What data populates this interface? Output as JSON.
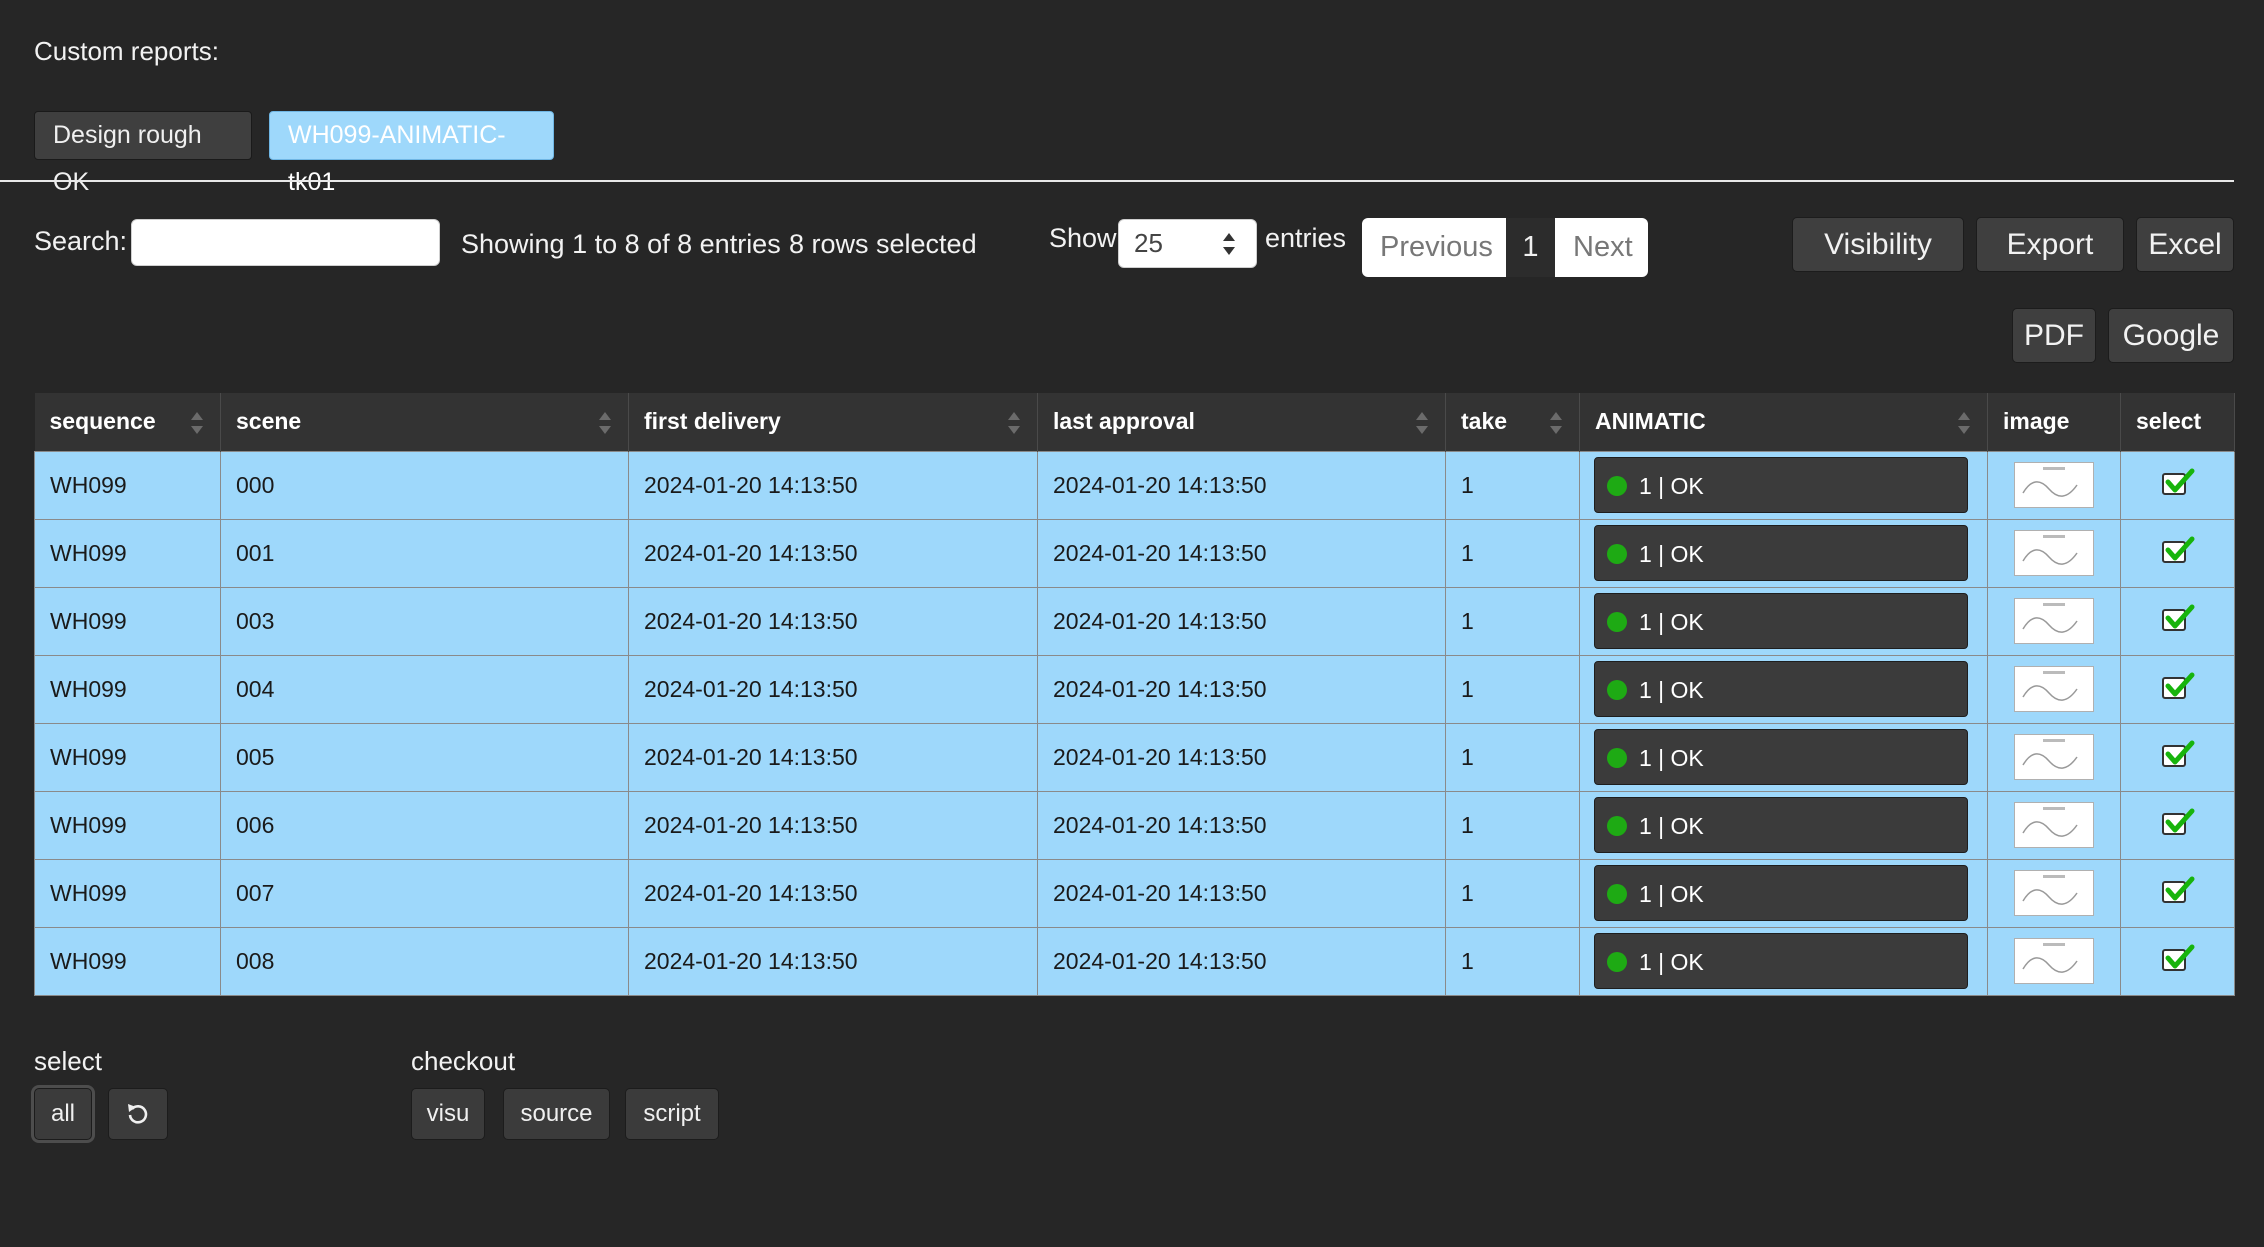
{
  "reports": {
    "title": "Custom reports:",
    "tabs": [
      {
        "label": "Design rough OK"
      },
      {
        "label": "WH099-ANIMATIC-tk01"
      }
    ]
  },
  "toolbar": {
    "search_label": "Search:",
    "search_value": "",
    "info": "Showing 1 to 8 of 8 entries",
    "selected_info": "8 rows selected",
    "show_label": "Show",
    "page_length": "25",
    "entries_label": "entries",
    "pager": {
      "previous": "Previous",
      "current": "1",
      "next": "Next"
    },
    "buttons": {
      "visibility": "Visibility",
      "export": "Export",
      "excel": "Excel",
      "pdf": "PDF",
      "google": "Google"
    }
  },
  "table": {
    "columns": [
      "sequence",
      "scene",
      "first delivery",
      "last approval",
      "take",
      "ANIMATIC",
      "image",
      "select"
    ],
    "rows": [
      {
        "sequence": "WH099",
        "scene": "000",
        "first_delivery": "2024-01-20 14:13:50",
        "last_approval": "2024-01-20 14:13:50",
        "take": "1",
        "animatic": "1 | OK"
      },
      {
        "sequence": "WH099",
        "scene": "001",
        "first_delivery": "2024-01-20 14:13:50",
        "last_approval": "2024-01-20 14:13:50",
        "take": "1",
        "animatic": "1 | OK"
      },
      {
        "sequence": "WH099",
        "scene": "003",
        "first_delivery": "2024-01-20 14:13:50",
        "last_approval": "2024-01-20 14:13:50",
        "take": "1",
        "animatic": "1 | OK"
      },
      {
        "sequence": "WH099",
        "scene": "004",
        "first_delivery": "2024-01-20 14:13:50",
        "last_approval": "2024-01-20 14:13:50",
        "take": "1",
        "animatic": "1 | OK"
      },
      {
        "sequence": "WH099",
        "scene": "005",
        "first_delivery": "2024-01-20 14:13:50",
        "last_approval": "2024-01-20 14:13:50",
        "take": "1",
        "animatic": "1 | OK"
      },
      {
        "sequence": "WH099",
        "scene": "006",
        "first_delivery": "2024-01-20 14:13:50",
        "last_approval": "2024-01-20 14:13:50",
        "take": "1",
        "animatic": "1 | OK"
      },
      {
        "sequence": "WH099",
        "scene": "007",
        "first_delivery": "2024-01-20 14:13:50",
        "last_approval": "2024-01-20 14:13:50",
        "take": "1",
        "animatic": "1 | OK"
      },
      {
        "sequence": "WH099",
        "scene": "008",
        "first_delivery": "2024-01-20 14:13:50",
        "last_approval": "2024-01-20 14:13:50",
        "take": "1",
        "animatic": "1 | OK"
      }
    ]
  },
  "bottom": {
    "select_label": "select",
    "all_label": "all",
    "reset_icon": "reset-icon",
    "checkout_label": "checkout",
    "checkout_buttons": [
      "visu",
      "source",
      "script"
    ]
  },
  "colors": {
    "background": "#262626",
    "row_selected": "#9ed8fb",
    "status_ok": "#1eaa14",
    "check": "#17b40c"
  }
}
